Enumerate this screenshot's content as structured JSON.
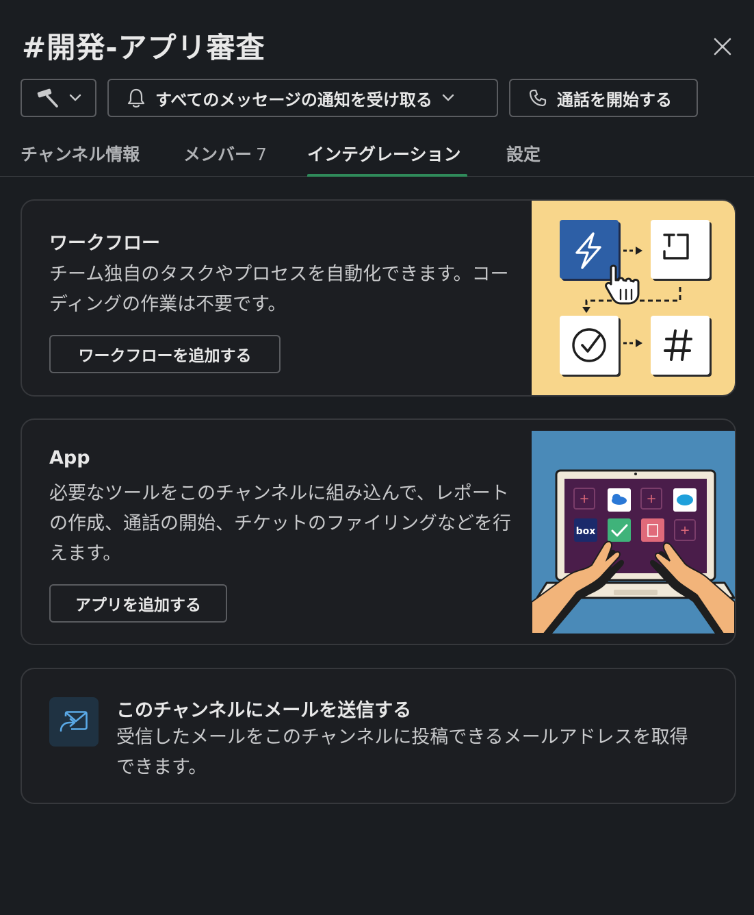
{
  "header": {
    "title": "#開発-アプリ審査",
    "notify_label": "すべてのメッセージの通知を受け取る",
    "call_label": "通話を開始する"
  },
  "tabs": [
    {
      "label": "チャンネル情報"
    },
    {
      "label": "メンバー",
      "count": "7"
    },
    {
      "label": "インテグレーション",
      "active": true
    },
    {
      "label": "設定"
    }
  ],
  "workflow": {
    "title": "ワークフロー",
    "description": "チーム独自のタスクやプロセスを自動化できます。コーディングの作業は不要です。",
    "button_label": "ワークフローを追加する"
  },
  "apps": {
    "title": "App",
    "description": "必要なツールをこのチャンネルに組み込んで、レポートの作成、通話の開始、チケットのファイリングなどを行えます。",
    "button_label": "アプリを追加する",
    "tile_labels": {
      "box": "box"
    }
  },
  "email": {
    "title": "このチャンネルにメールを送信する",
    "description": "受信したメールをこのチャンネルに投稿できるメールアドレスを取得できます。"
  },
  "colors": {
    "background": "#1a1d21",
    "accent_tab": "#2f8a5a",
    "workflow_illustration_bg": "#f8d68b",
    "app_illustration_bg": "#4a8ab8",
    "laptop_screen": "#4a1d4a"
  },
  "icons": [
    "hammer-icon",
    "chevron-down-icon",
    "bell-icon",
    "phone-icon",
    "close-icon",
    "lightning-icon",
    "text-icon",
    "check-circle-icon",
    "hash-icon",
    "pointer-hand-icon",
    "email-forward-icon"
  ]
}
